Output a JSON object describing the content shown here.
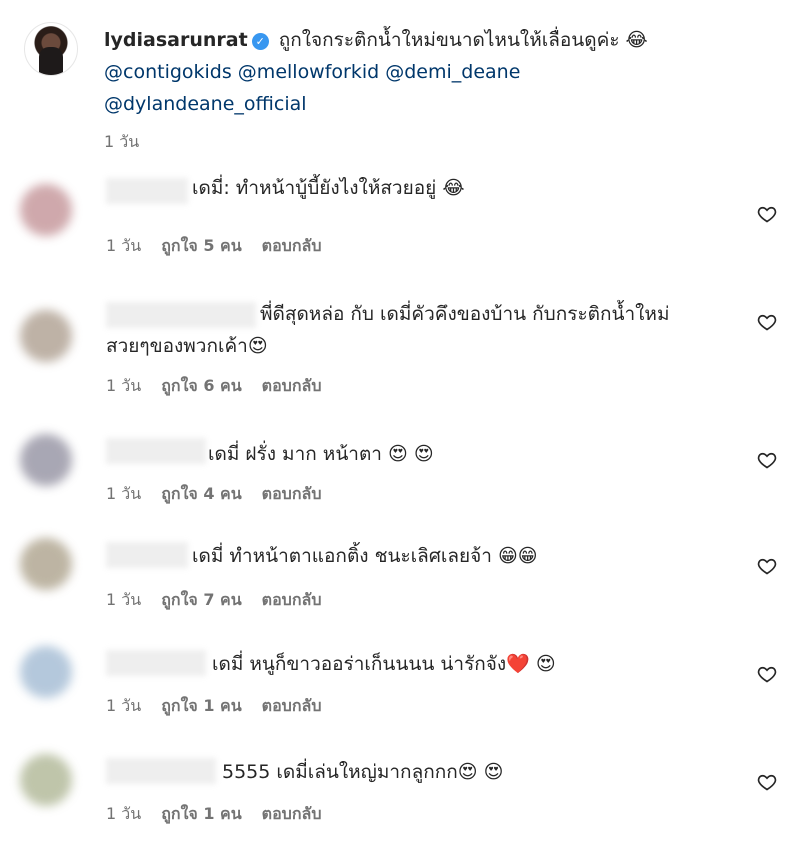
{
  "caption": {
    "username": "lydiasarunrat",
    "text": "ถูกใจกระติกน้ำใหม่ขนาดไหนให้เลื่อนดูค่ะ 😂",
    "mentions_line1": "@contigokids @mellowforkid @demi_deane",
    "mentions_line2": "@dylandeane_official",
    "time": "1 วัน"
  },
  "comments": [
    {
      "text": "เดมี่: ทำหน้าบู้บี้ยังไงให้สวยอยู่ 😂",
      "time": "1 วัน",
      "likes": "ถูกใจ 5 คน",
      "reply": "ตอบกลับ",
      "avatar_color": "#c79a9e"
    },
    {
      "text": "พี่ดีสุดหล่อ กับ เดมี่คัวคึงของบ้าน กับกระติกน้ำใหม่",
      "text2": "สวยๆของพวกเค้า😍",
      "time": "1 วัน",
      "likes": "ถูกใจ 6 คน",
      "reply": "ตอบกลับ",
      "avatar_color": "#b3a597"
    },
    {
      "text": "เดมี่ ฝรั่ง มาก หน้าตา 😍 😍",
      "time": "1 วัน",
      "likes": "ถูกใจ 4 คน",
      "reply": "ตอบกลับ",
      "avatar_color": "#9a98a7"
    },
    {
      "text": "เดมี่ ทำหน้าตาแอกติ้ง ชนะเลิศเลยจ้า 😁😁",
      "time": "1 วัน",
      "likes": "ถูกใจ 7 คน",
      "reply": "ตอบกลับ",
      "avatar_color": "#b2a893"
    },
    {
      "text": "เดมี่ หนูก็ขาวออร่าเก็นนนน น่ารักจัง❤️ 😍",
      "time": "1 วัน",
      "likes": "ถูกใจ 1 คน",
      "reply": "ตอบกลับ",
      "avatar_color": "#a8bfd6"
    },
    {
      "text": "5555 เดมี่เล่นใหญ่มากลูกกก😍 😍",
      "time": "1 วัน",
      "likes": "ถูกใจ 1 คน",
      "reply": "ตอบกลับ",
      "avatar_color": "#b4bb9c"
    }
  ]
}
